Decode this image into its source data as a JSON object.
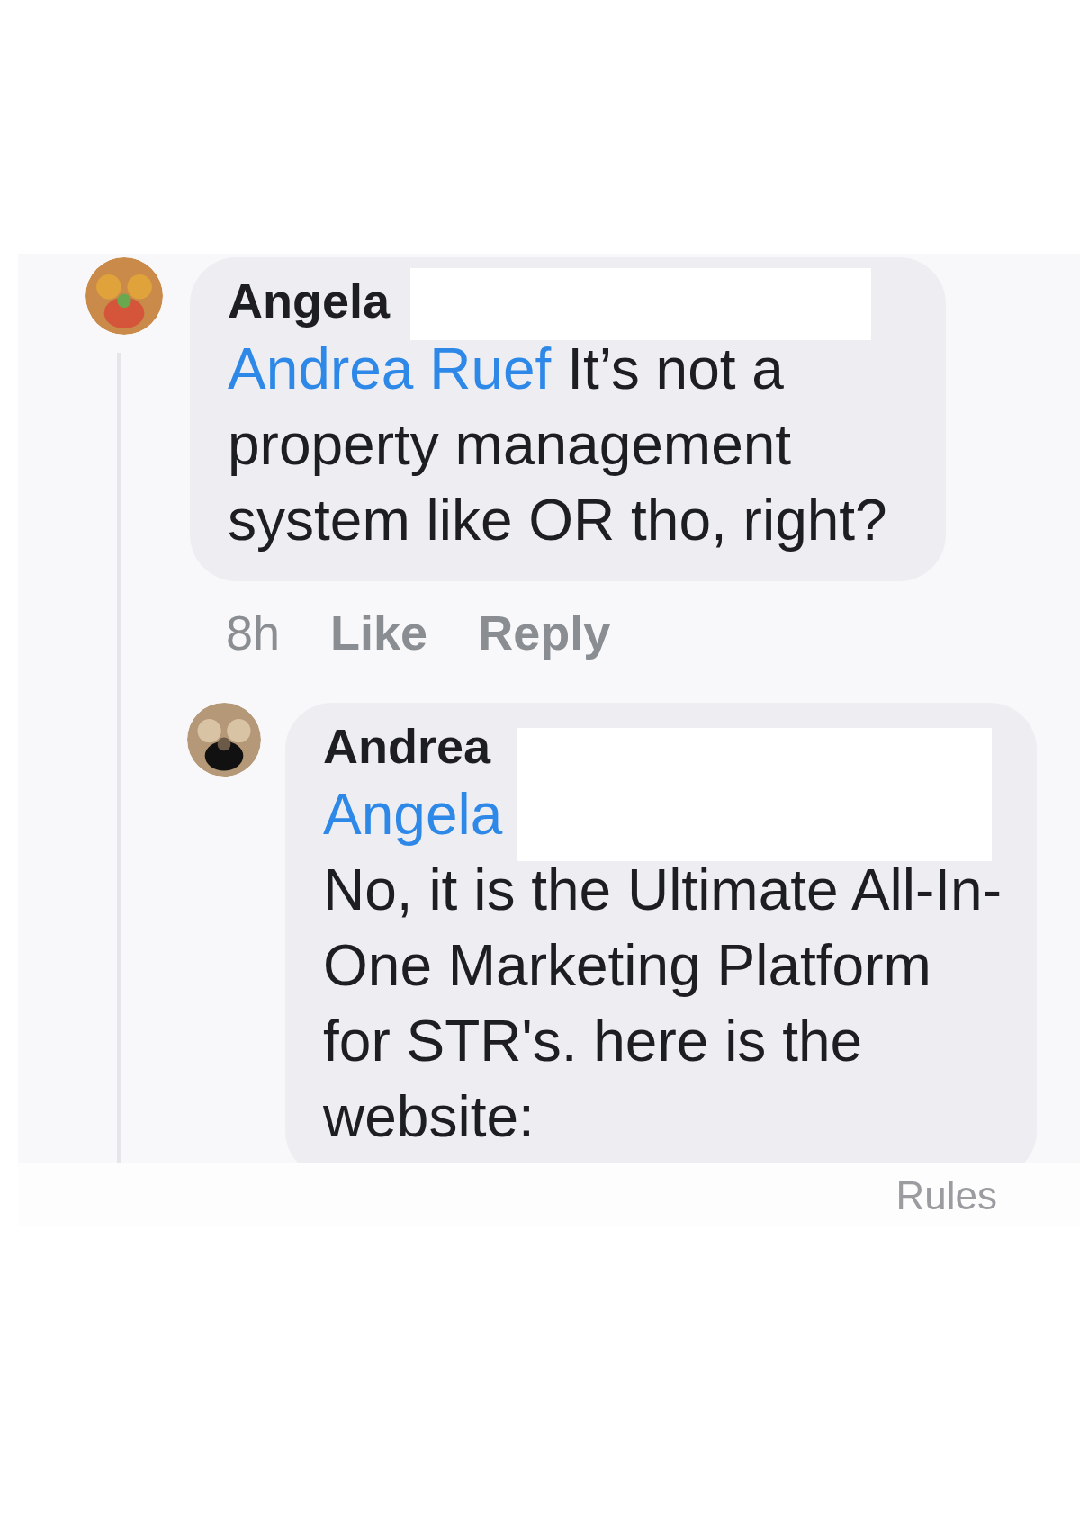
{
  "comments": [
    {
      "author": "Angela",
      "redacted": true,
      "mention": "Andrea Ruef",
      "mention_on_own_line": false,
      "text": "It’s not a property management system like OR tho, right?",
      "time": "8h",
      "actions": [
        "Like",
        "Reply"
      ]
    },
    {
      "author": "Andrea",
      "redacted": true,
      "mention": "Angela",
      "mention_on_own_line": true,
      "text": "No, it is the Ultimate All-In-One Marketing Platform for STR's. here is the website:"
    }
  ],
  "footer": {
    "link": "Rules"
  }
}
